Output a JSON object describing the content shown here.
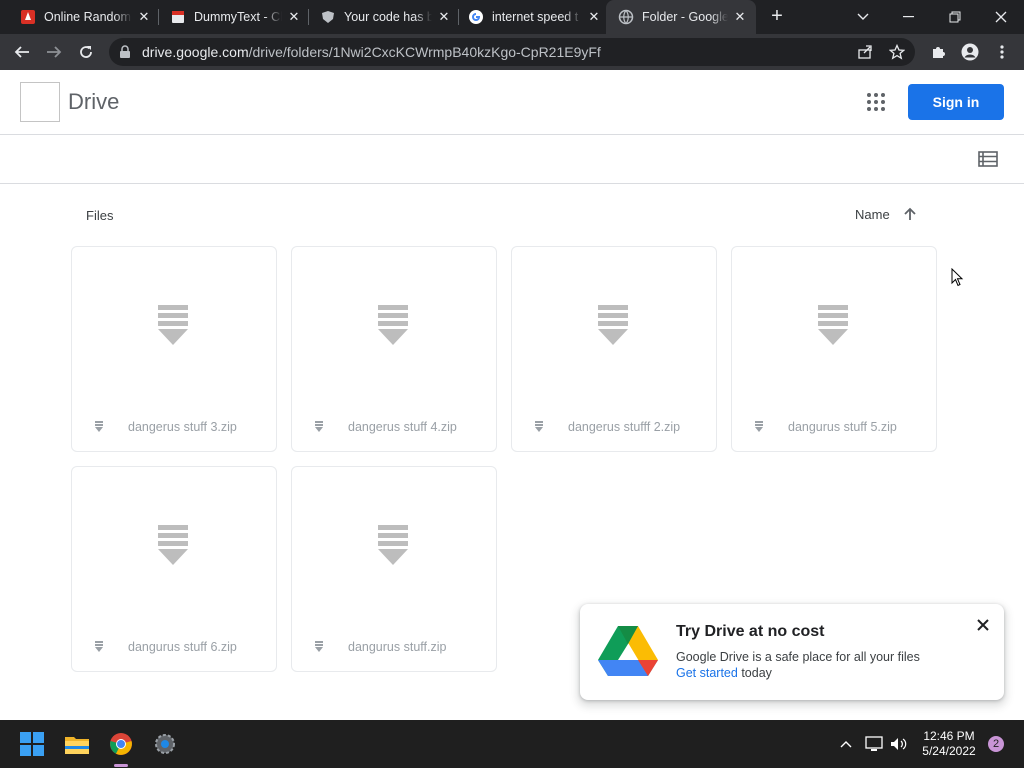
{
  "browser": {
    "tabs": [
      {
        "title": "Online Random",
        "favicon": "flame-icon",
        "active": false
      },
      {
        "title": "DummyText - Cl",
        "favicon": "doc-icon",
        "active": false
      },
      {
        "title": "Your code has b",
        "favicon": "shield-icon",
        "active": false
      },
      {
        "title": "internet speed t",
        "favicon": "google-g-icon",
        "active": false
      },
      {
        "title": "Folder - Google",
        "favicon": "globe-icon",
        "active": true
      }
    ],
    "url_host": "drive.google.com",
    "url_path": "/drive/folders/1Nwi2CxcKCWrmpB40kzKgo-CpR21E9yFf"
  },
  "drive": {
    "title": "Drive",
    "signin_label": "Sign in",
    "files_label": "Files",
    "sort_label": "Name"
  },
  "files": [
    {
      "name": "dangerus stuff 3.zip"
    },
    {
      "name": "dangerus stuff 4.zip"
    },
    {
      "name": "dangerus stufff 2.zip"
    },
    {
      "name": "dangurus stuff 5.zip"
    },
    {
      "name": "dangurus stuff 6.zip"
    },
    {
      "name": "dangurus stuff.zip"
    }
  ],
  "promo": {
    "title": "Try Drive at no cost",
    "body": "Google Drive is a safe place for all your files",
    "link": "Get started",
    "link_suffix": " today"
  },
  "taskbar": {
    "time": "12:46 PM",
    "date": "5/24/2022",
    "notifications": "2"
  },
  "colors": {
    "accent": "#1a73e8",
    "chrome_dark": "#202124",
    "taskbar": "#1f1f1f"
  }
}
